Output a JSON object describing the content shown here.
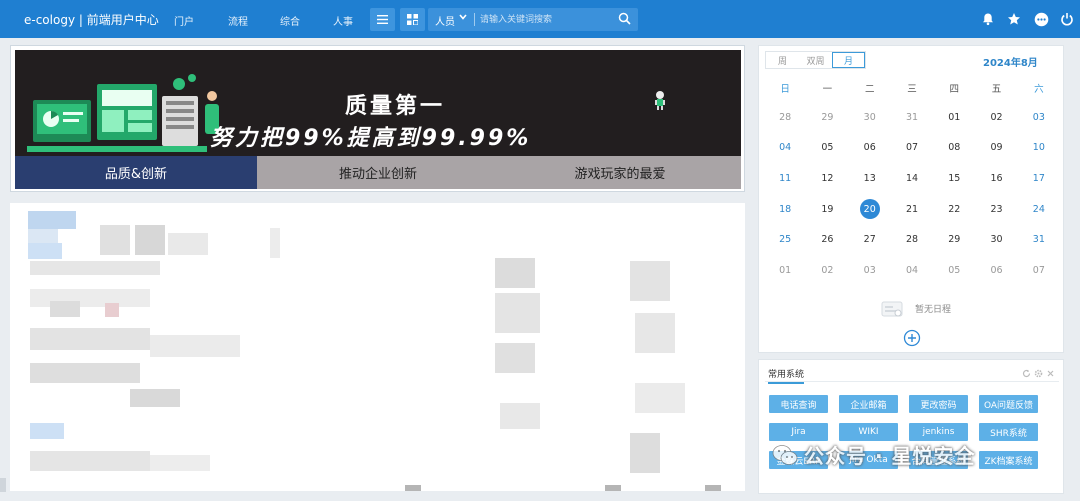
{
  "app": {
    "brand": "e-cology | 前端用户中心"
  },
  "nav": [
    "门户",
    "流程",
    "综合",
    "人事"
  ],
  "toolbar": {
    "menu_icon": "hamburger-icon",
    "apps_icon": "grid-icon"
  },
  "search": {
    "category": "人员",
    "placeholder": "请输入关键词搜索"
  },
  "top_right_icons": [
    "bell-icon",
    "star-icon",
    "more-icon",
    "power-icon"
  ],
  "banner": {
    "line1": "质量第一",
    "line2": "努力把99%提高到99.99%",
    "tabs": [
      "品质&创新",
      "推动企业创新",
      "游戏玩家的最爱"
    ],
    "active_tab": 0
  },
  "calendar": {
    "view_tabs": [
      "周",
      "双周",
      "月"
    ],
    "active_view": 2,
    "title": "2024年8月",
    "weekdays": [
      "日",
      "一",
      "二",
      "三",
      "四",
      "五",
      "六"
    ],
    "weeks": [
      [
        "28",
        "29",
        "30",
        "31",
        "01",
        "02",
        "03"
      ],
      [
        "04",
        "05",
        "06",
        "07",
        "08",
        "09",
        "10"
      ],
      [
        "11",
        "12",
        "13",
        "14",
        "15",
        "16",
        "17"
      ],
      [
        "18",
        "19",
        "20",
        "21",
        "22",
        "23",
        "24"
      ],
      [
        "25",
        "26",
        "27",
        "28",
        "29",
        "30",
        "31"
      ],
      [
        "01",
        "02",
        "03",
        "04",
        "05",
        "06",
        "07"
      ]
    ],
    "today": "20",
    "no_event_text": "暂无日程"
  },
  "common_systems": {
    "title": "常用系统",
    "buttons": [
      "电话查询",
      "企业邮箱",
      "更改密码",
      "OA问题反馈",
      "Jira",
      "WIKI",
      "jenkins",
      "SHR系统",
      "金蝶云ERP",
      "Jira Okta",
      "合同管理系统",
      "ZK档案系统"
    ]
  },
  "watermark": {
    "text": "公众号 · 星悦安全"
  },
  "colors": {
    "topbar": "#1f7fd1",
    "accent": "#2e89d6",
    "banner_active_tab": "#2a3e70",
    "system_button": "#5db0e7"
  }
}
